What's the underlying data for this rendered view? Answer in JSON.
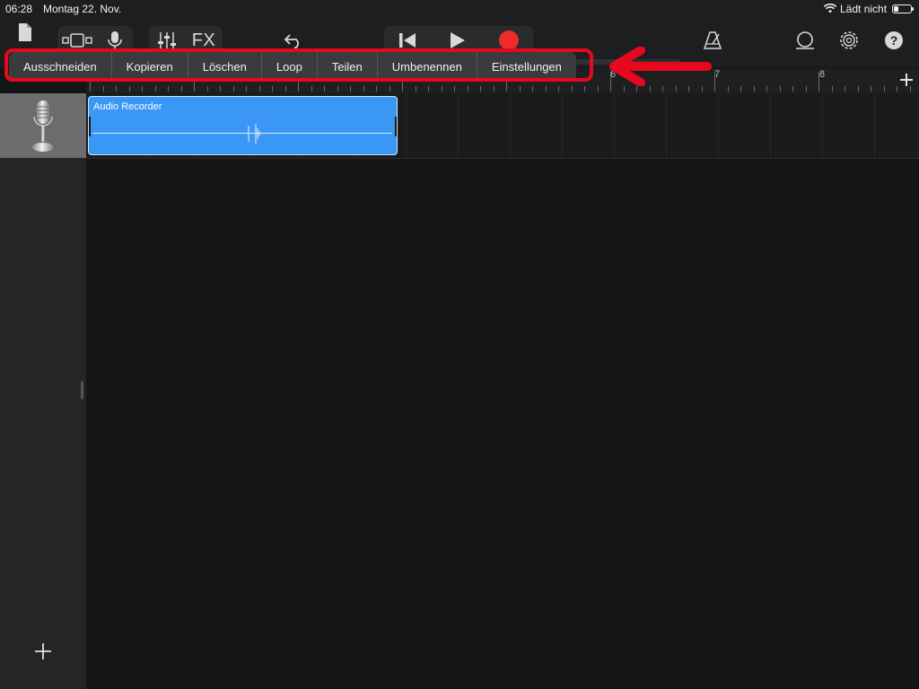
{
  "status_bar": {
    "time": "06:28",
    "date": "Montag 22. Nov.",
    "charging_status": "Lädt nicht",
    "battery_level": 0.3
  },
  "toolbar": {
    "fx_label": "FX",
    "icons": [
      "document-icon",
      "track-view-icon",
      "microphone-icon",
      "mixer-icon",
      "undo-icon",
      "go-to-start-icon",
      "play-icon",
      "record-icon",
      "metronome-icon",
      "loop-browser-icon",
      "settings-gear-icon",
      "help-icon"
    ],
    "record_color": "#ee2a2a",
    "master_volume": 0.0
  },
  "context_menu": {
    "items": [
      "Ausschneiden",
      "Kopieren",
      "Löschen",
      "Loop",
      "Teilen",
      "Umbenennen",
      "Einstellungen"
    ],
    "highlight_color": "#e8081d"
  },
  "ruler": {
    "bar_numbers": [
      "6",
      "7",
      "8"
    ]
  },
  "track": {
    "instrument_icon": "microphone-icon",
    "region": {
      "name": "Audio Recorder",
      "color": "#3a97f5"
    }
  },
  "sidebar": {
    "add_icon": "plus-icon"
  }
}
